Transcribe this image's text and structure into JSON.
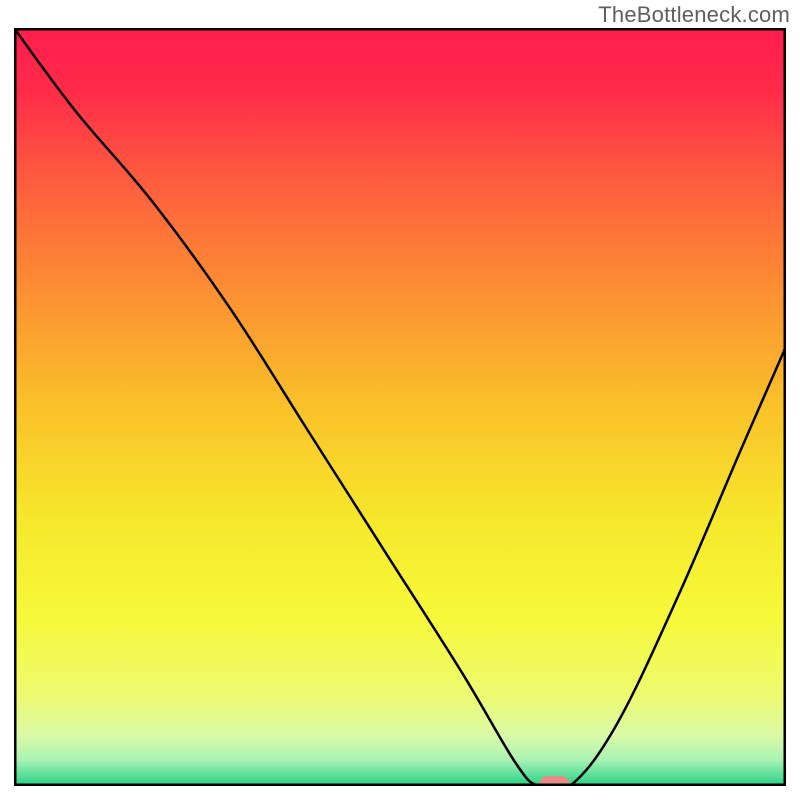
{
  "watermark": "TheBottleneck.com",
  "chart_data": {
    "type": "line",
    "title": "",
    "xlabel": "",
    "ylabel": "",
    "xlim": [
      0,
      100
    ],
    "ylim": [
      0,
      100
    ],
    "gradient_stops": [
      {
        "offset": 0.0,
        "color": "#ff1d4e"
      },
      {
        "offset": 0.08,
        "color": "#ff2a49"
      },
      {
        "offset": 0.2,
        "color": "#fe5c3e"
      },
      {
        "offset": 0.35,
        "color": "#fc9032"
      },
      {
        "offset": 0.5,
        "color": "#fac229"
      },
      {
        "offset": 0.65,
        "color": "#f6e82b"
      },
      {
        "offset": 0.78,
        "color": "#f6f93a"
      },
      {
        "offset": 0.88,
        "color": "#eefb70"
      },
      {
        "offset": 0.935,
        "color": "#d9faa8"
      },
      {
        "offset": 0.965,
        "color": "#a9f2b3"
      },
      {
        "offset": 0.985,
        "color": "#5fe09c"
      },
      {
        "offset": 1.0,
        "color": "#29d07f"
      }
    ],
    "series": [
      {
        "name": "bottleneck-curve",
        "x": [
          0,
          8,
          18,
          28,
          38,
          48,
          58,
          65,
          68,
          72,
          78,
          86,
          94,
          100
        ],
        "values": [
          100,
          89,
          77,
          63,
          47,
          31,
          15,
          3,
          0,
          0,
          8,
          25,
          44,
          58
        ]
      }
    ],
    "marker": {
      "name": "optimal-point",
      "x": 70,
      "y": 0,
      "color": "#e88b87"
    },
    "axes_visible": false,
    "border_visible": true
  }
}
